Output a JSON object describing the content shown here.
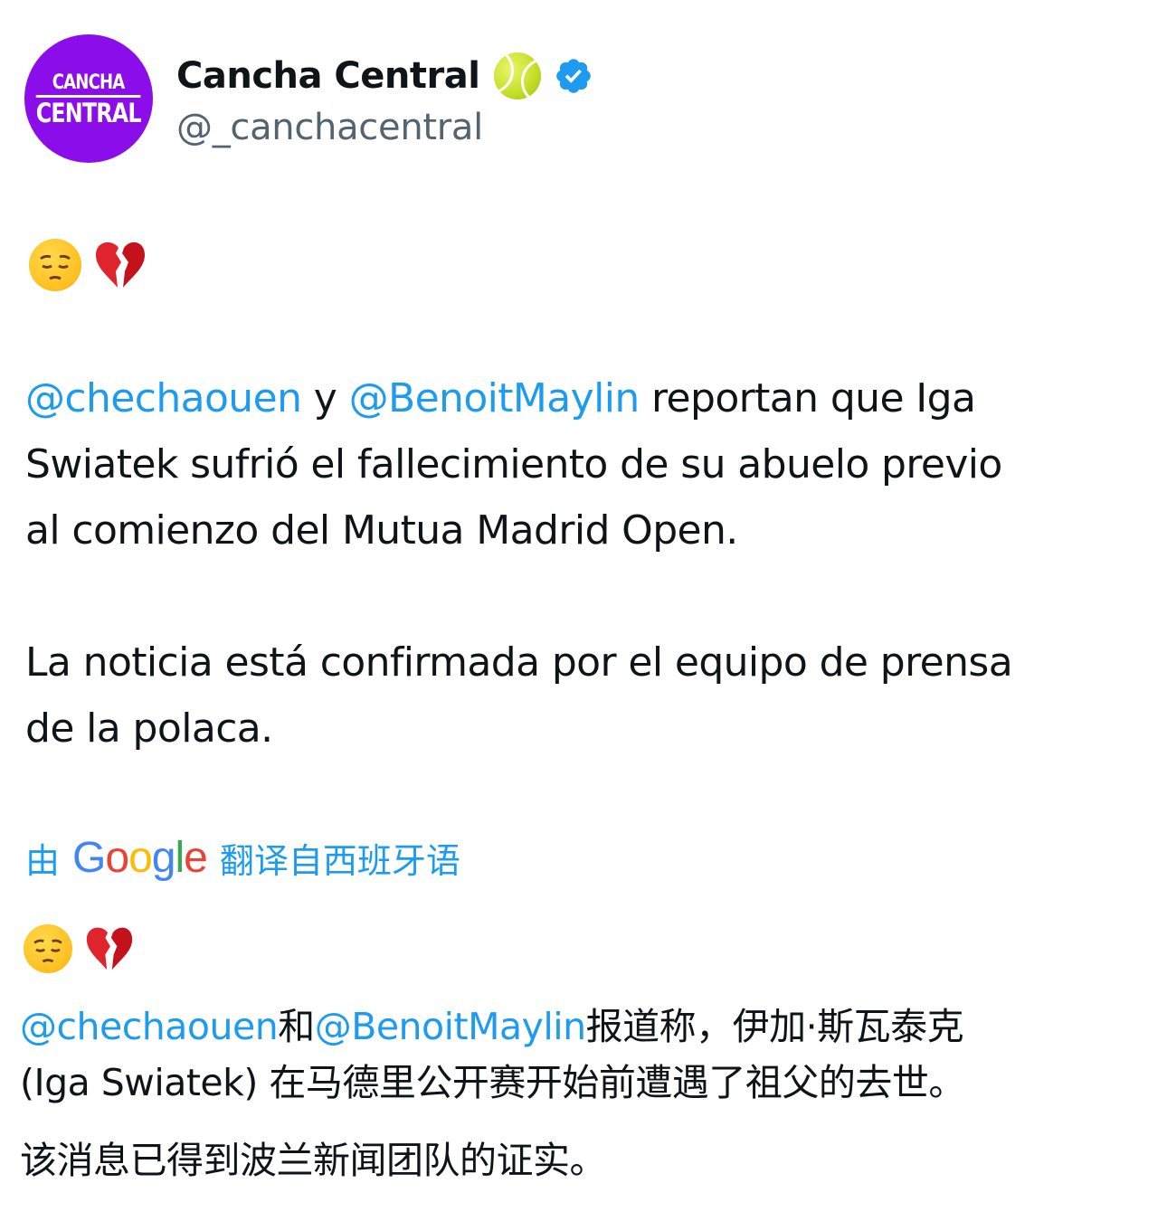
{
  "account": {
    "avatar_line1": "CANCHA",
    "avatar_line2": "CENTRAL",
    "display_name": "Cancha Central",
    "handle": "@_canchacentral",
    "badge_emoji": "tennis-ball-icon",
    "verified_icon": "verified-badge-icon",
    "avatar_color": "#8a0dea",
    "verified_color": "#1d9bf0"
  },
  "tweet": {
    "emoji_line": [
      "pensive-face-icon",
      "broken-heart-icon"
    ],
    "mention1": "@chechaouen",
    "connector": " y ",
    "mention2": "@BenoitMaylin",
    "p1_rest_line1": " reportan que Iga",
    "p1_line2": "Swiatek sufrió el fallecimiento de su abuelo previo",
    "p1_line3": "al comienzo del Mutua Madrid Open.",
    "p2_line1": "La noticia está confirmada por el equipo de prensa",
    "p2_line2": "de la polaca."
  },
  "translation": {
    "prefix": "由",
    "provider": "Google",
    "suffix": "翻译自西班牙语",
    "emoji_line": [
      "pensive-face-icon",
      "broken-heart-icon"
    ],
    "mention1": "@chechaouen",
    "connector": "和",
    "mention2": "@BenoitMaylin",
    "line1_rest": "报道称，伊加·斯瓦泰克",
    "line2": "(Iga Swiatek) 在马德里公开赛开始前遭遇了祖父的去世。",
    "line3": "该消息已得到波兰新闻团队的证实。"
  },
  "colors": {
    "link": "#1d9bf0",
    "text": "#0f1419",
    "secondary": "#536471"
  }
}
